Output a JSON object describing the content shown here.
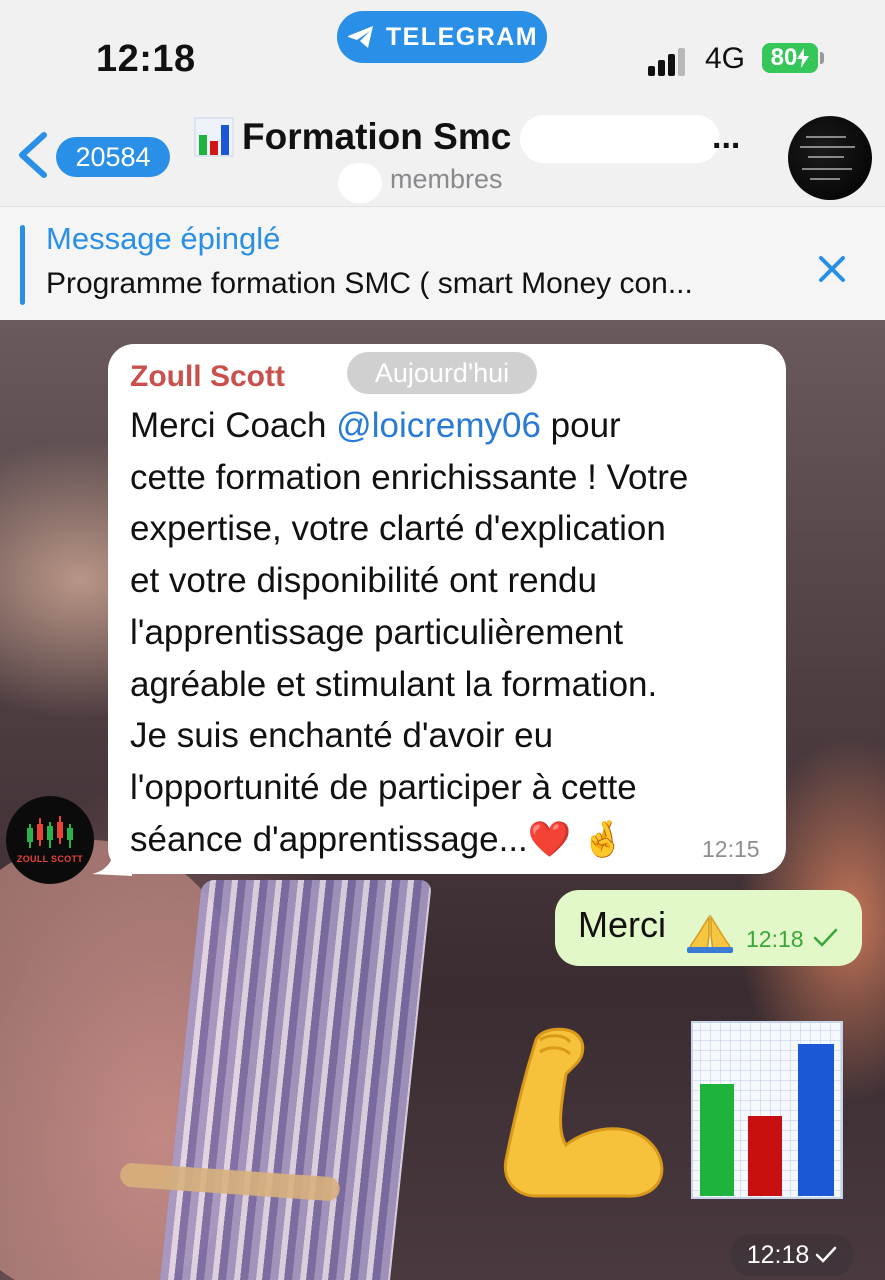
{
  "status_bar": {
    "time": "12:18",
    "app_pill": "TELEGRAM",
    "network": "4G",
    "battery": "80"
  },
  "header": {
    "unread_count": "20584",
    "title": "Formation Smc",
    "title_ellipsis": "...",
    "subtitle": "membres"
  },
  "pinned": {
    "label": "Message épinglé",
    "text": "Programme formation SMC ( smart Money con..."
  },
  "messages": {
    "incoming": {
      "sender": "Zoull Scott",
      "date_chip": "Aujourd'hui",
      "lines": [
        "Merci Coach ",
        "cette formation enrichissante ! Votre",
        "expertise, votre clarté d'explication",
        "et votre disponibilité ont rendu",
        "l'apprentissage particulièrement",
        "agréable et stimulant la formation.",
        "Je suis enchanté d'avoir eu",
        "l'opportunité de participer à cette",
        "séance d'apprentissage..."
      ],
      "mention": "@loicremy06",
      "after_mention": " pour",
      "emojis": "❤️ 🤞",
      "time": "12:15",
      "avatar_label": "ZOULL SCOTT"
    },
    "outgoing": {
      "text": "Merci",
      "time": "12:18"
    },
    "sticker": {
      "time": "12:18"
    }
  },
  "colors": {
    "telegram_blue": "#2a8fe6",
    "sender_name": "#c9504c",
    "outgoing_bubble": "#e2f8c8",
    "outgoing_time": "#3aa63a"
  }
}
